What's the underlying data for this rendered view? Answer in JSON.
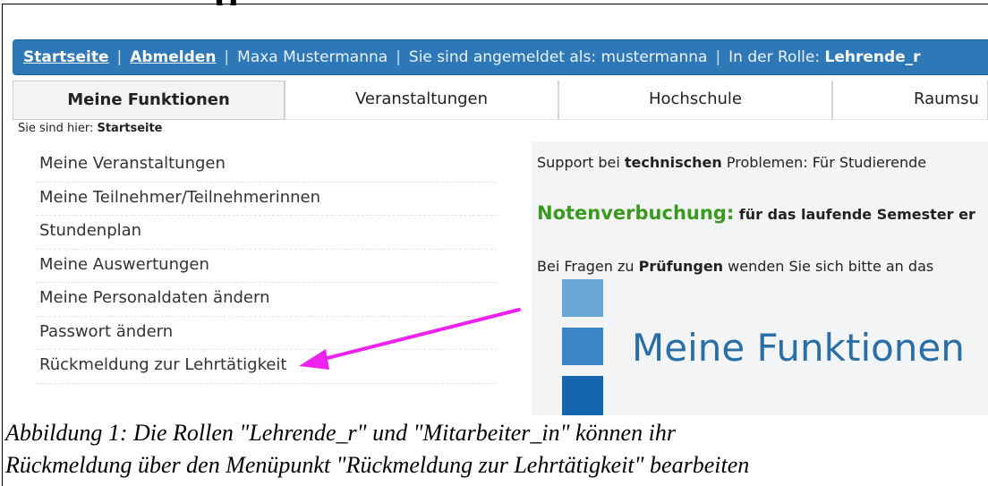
{
  "document": {
    "heading_fragment": "g"
  },
  "topbar": {
    "startseite": "Startseite",
    "abmelden": "Abmelden",
    "user_name": "Maxa Mustermanna",
    "logged_in_prefix": "Sie sind angemeldet als: ",
    "login_name": "mustermanna",
    "role_prefix": "In der Rolle: ",
    "role": "Lehrende_r"
  },
  "tabs": [
    {
      "label": "Meine Funktionen",
      "active": true
    },
    {
      "label": "Veranstaltungen",
      "active": false
    },
    {
      "label": "Hochschule",
      "active": false
    },
    {
      "label": "Raumsu",
      "active": false
    }
  ],
  "breadcrumb": {
    "prefix": "Sie sind hier: ",
    "current": "Startseite"
  },
  "sidebar": {
    "items": [
      {
        "label": "Meine Veranstaltungen"
      },
      {
        "label": "Meine Teilnehmer/Teilnehmerinnen"
      },
      {
        "label": "Stundenplan"
      },
      {
        "label": "Meine Auswertungen"
      },
      {
        "label": "Meine Personaldaten ändern"
      },
      {
        "label": "Passwort ändern"
      },
      {
        "label": "Rückmeldung zur Lehrtätigkeit"
      }
    ]
  },
  "content": {
    "support": {
      "before": "Support bei ",
      "bold": "technischen",
      "after": " Problemen: Für Studierende"
    },
    "notice": {
      "headline": "Notenverbuchung:",
      "text": " für das laufende Semester er"
    },
    "questions": {
      "before": "Bei Fragen zu ",
      "bold": "Prüfungen",
      "after": " wenden Sie sich bitte an das"
    },
    "section_title": "Meine Funktionen"
  },
  "colors": {
    "topbar_bg": "#2f78b8",
    "notice_green": "#3a9a1f",
    "arrow_magenta": "#ee22ee",
    "title_blue": "#2a6ea8"
  },
  "caption": {
    "line1": "Abbildung 1: Die Rollen \"Lehrende_r\" und \"Mitarbeiter_in\" können ihr",
    "line2": "Rückmeldung über den Menüpunkt \"Rückmeldung zur Lehrtätigkeit\" bearbeiten"
  }
}
